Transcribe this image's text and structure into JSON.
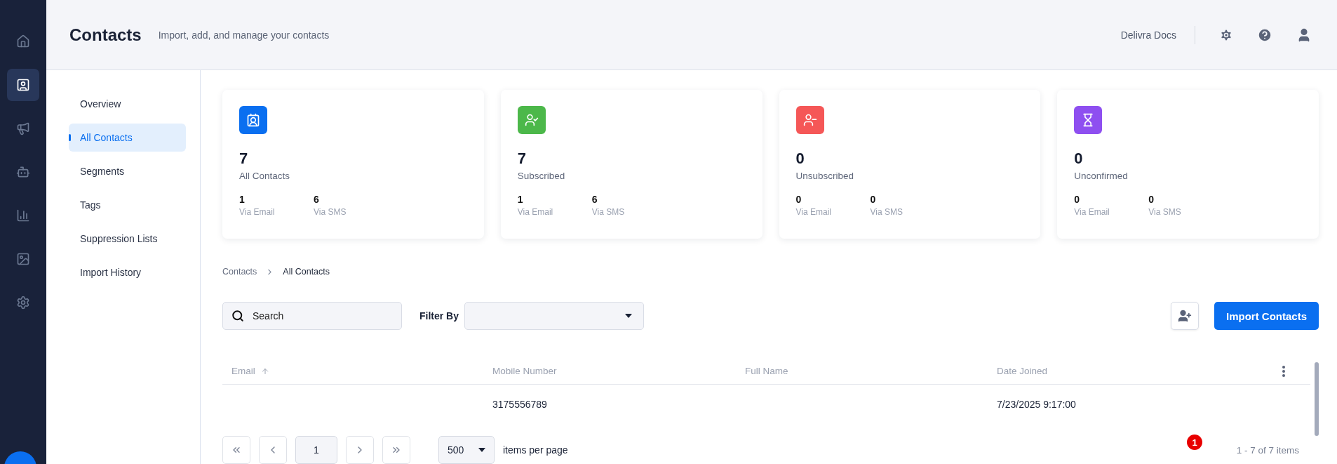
{
  "rail": {
    "items": [
      {
        "kind": "home",
        "selected": false
      },
      {
        "kind": "contacts",
        "selected": true
      },
      {
        "kind": "campaigns",
        "selected": false
      },
      {
        "kind": "automation",
        "selected": false
      },
      {
        "kind": "reports",
        "selected": false
      },
      {
        "kind": "media",
        "selected": false
      },
      {
        "kind": "settings",
        "selected": false
      }
    ]
  },
  "header": {
    "title": "Contacts",
    "subtitle": "Import, add, and manage your contacts",
    "docs_link": "Delivra Docs"
  },
  "subnav": {
    "items": [
      {
        "label": "Overview",
        "selected": false
      },
      {
        "label": "All Contacts",
        "selected": true
      },
      {
        "label": "Segments",
        "selected": false
      },
      {
        "label": "Tags",
        "selected": false
      },
      {
        "label": "Suppression Lists",
        "selected": false
      },
      {
        "label": "Import History",
        "selected": false
      }
    ]
  },
  "cards": [
    {
      "kind": "contacts",
      "color": "#0a6ff0",
      "value": "7",
      "label": "All Contacts",
      "stats": [
        {
          "value": "1",
          "label": "Via Email"
        },
        {
          "value": "6",
          "label": "Via SMS"
        }
      ]
    },
    {
      "kind": "subscribed",
      "color": "#4cb84a",
      "value": "7",
      "label": "Subscribed",
      "stats": [
        {
          "value": "1",
          "label": "Via Email"
        },
        {
          "value": "6",
          "label": "Via SMS"
        }
      ]
    },
    {
      "kind": "unsubscribed",
      "color": "#f55757",
      "value": "0",
      "label": "Unsubscribed",
      "stats": [
        {
          "value": "0",
          "label": "Via Email"
        },
        {
          "value": "0",
          "label": "Via SMS"
        }
      ]
    },
    {
      "kind": "unconfirmed",
      "color": "#8e4ff0",
      "value": "0",
      "label": "Unconfirmed",
      "stats": [
        {
          "value": "0",
          "label": "Via Email"
        },
        {
          "value": "0",
          "label": "Via SMS"
        }
      ]
    }
  ],
  "breadcrumb": [
    "Contacts",
    "All Contacts"
  ],
  "toolbar": {
    "search_placeholder": "Search",
    "filter_label": "Filter By",
    "import_button": "Import Contacts"
  },
  "table": {
    "columns": [
      {
        "label": "Email",
        "sorted": true
      },
      {
        "label": "Mobile Number",
        "sorted": false
      },
      {
        "label": "Full Name",
        "sorted": false
      },
      {
        "label": "Date Joined",
        "sorted": false
      }
    ],
    "rows": [
      [
        "",
        "3175556789",
        "",
        "7/23/2025 9:17:00"
      ]
    ]
  },
  "pagination": {
    "page": "1",
    "page_size": "500",
    "page_size_label": "items per page",
    "summary": "1 - 7 of 7 items",
    "badge": "1"
  }
}
